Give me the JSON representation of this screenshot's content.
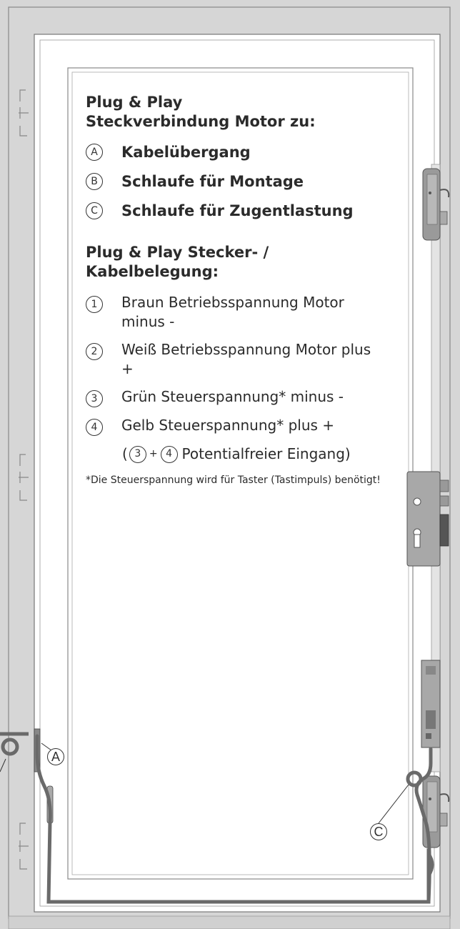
{
  "heading_1": [
    "Plug & Play",
    "Steckverbindung Motor zu:"
  ],
  "lettered_items": [
    {
      "letter": "A",
      "label": "Kabelübergang"
    },
    {
      "letter": "B",
      "label": "Schlaufe für Montage"
    },
    {
      "letter": "C",
      "label": "Schlaufe für Zugentlastung"
    }
  ],
  "heading_2": [
    "Plug & Play Stecker- /",
    "Kabelbelegung:"
  ],
  "numbered_items": [
    {
      "num": "1",
      "label": "Braun Betriebsspannung Motor minus -"
    },
    {
      "num": "2",
      "label": "Weiß Betriebsspannung Motor plus +"
    },
    {
      "num": "3",
      "label": "Grün Steuerspannung* minus -"
    },
    {
      "num": "4",
      "label": "Gelb Steuerspannung* plus +"
    }
  ],
  "potential_free": {
    "open": "(",
    "a": "3",
    "plus": "+",
    "b": "4",
    "text": "Potentialfreier Eingang)"
  },
  "footnote": "*Die Steuerspannung wird für Taster (Tastimpuls) benötigt!",
  "diagram_labels": {
    "a": "A",
    "c": "C"
  }
}
